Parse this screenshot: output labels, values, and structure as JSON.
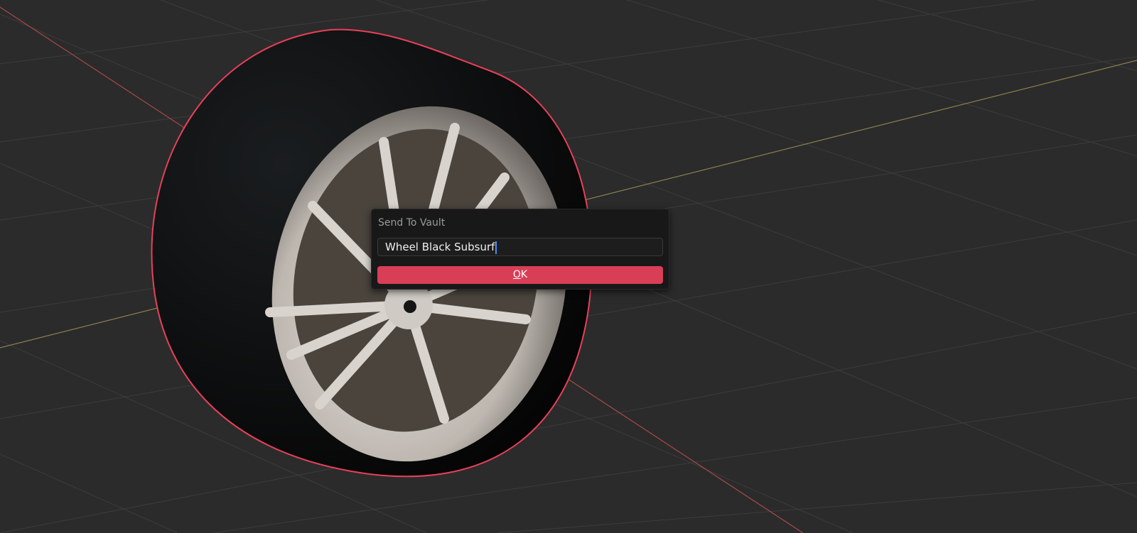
{
  "dialog": {
    "title": "Send To Vault",
    "name_value": "Wheel Black Subsurf",
    "ok_label_underlined": "O",
    "ok_label_rest": "K"
  },
  "colors": {
    "accent": "#d83f57",
    "selection_outline": "#e8405a",
    "x_axis": "#a84a4a",
    "y_axis": "#8a8050",
    "viewport_bg": "#2b2b2b"
  }
}
